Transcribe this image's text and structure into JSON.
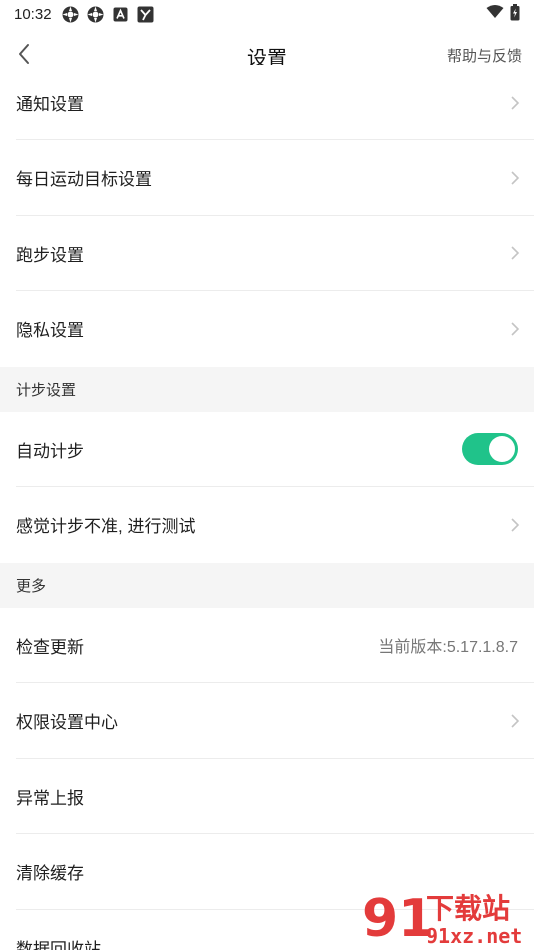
{
  "status_bar": {
    "time": "10:32",
    "icons": [
      "app-icon-1",
      "app-icon-2",
      "a-icon",
      "y-icon"
    ],
    "right_icons": [
      "wifi-icon",
      "battery-icon"
    ]
  },
  "nav": {
    "title": "设置",
    "help_label": "帮助与反馈"
  },
  "rows_top": [
    {
      "label": "通知设置"
    },
    {
      "label": "每日运动目标设置"
    },
    {
      "label": "跑步设置"
    },
    {
      "label": "隐私设置"
    }
  ],
  "section_step": {
    "title": "计步设置",
    "auto_step_label": "自动计步",
    "auto_step_on": true,
    "test_label": "感觉计步不准, 进行测试"
  },
  "section_more": {
    "title": "更多",
    "check_update_label": "检查更新",
    "version_text": "当前版本:5.17.1.8.7",
    "permission_label": "权限设置中心",
    "report_label": "异常上报",
    "clear_cache_label": "清除缓存",
    "recycle_label": "数据回收站"
  },
  "watermark": {
    "text1": "91",
    "text2": "下载站",
    "text3": "91xz.net"
  },
  "colors": {
    "accent": "#20c38a",
    "section_bg": "#f5f5f5",
    "watermark": "#e33b3b"
  }
}
